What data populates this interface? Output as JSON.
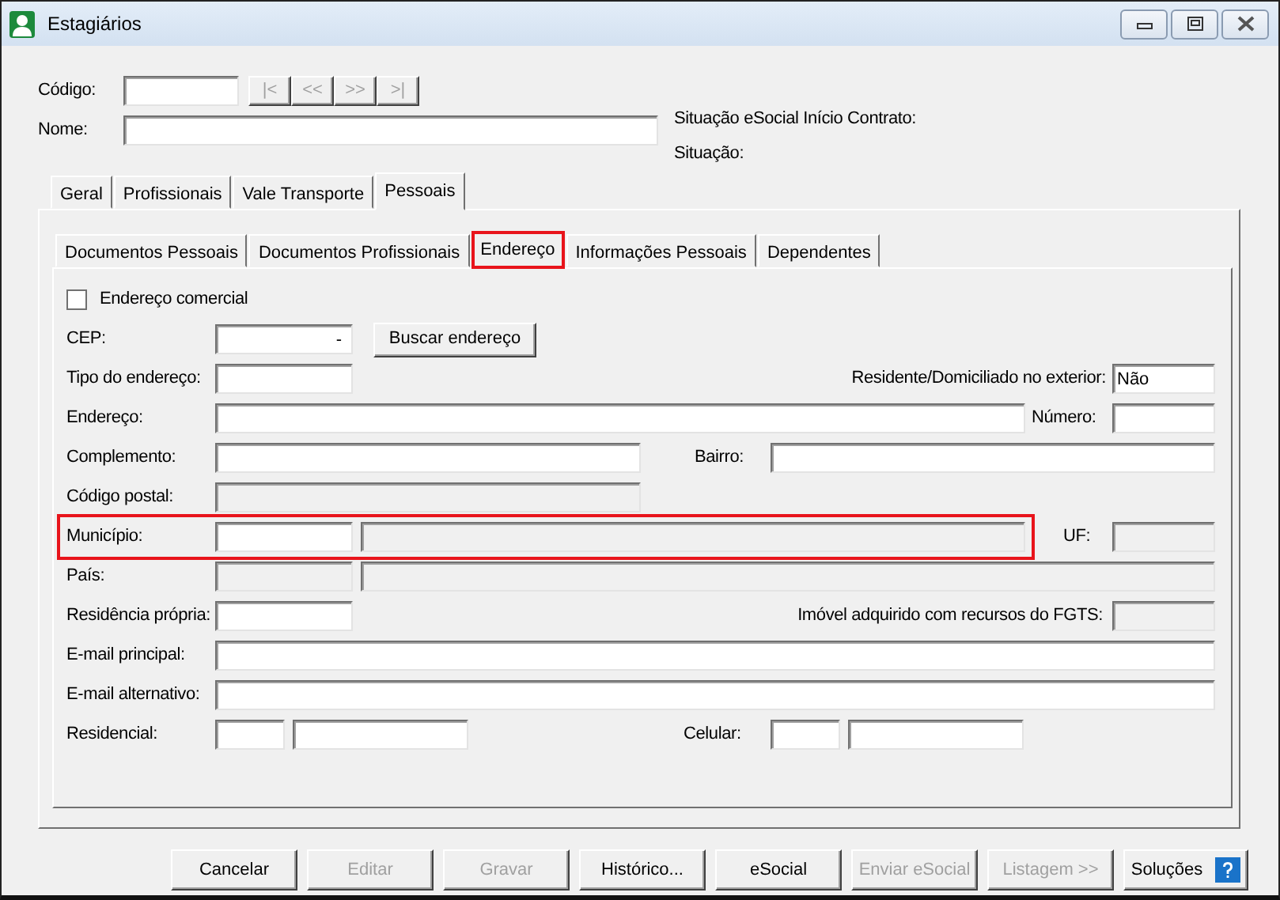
{
  "window": {
    "title": "Estagiários"
  },
  "header": {
    "codigo_label": "Código:",
    "nav_buttons": [
      {
        "label": "|<",
        "disabled": true
      },
      {
        "label": "<<",
        "disabled": true
      },
      {
        "label": ">>",
        "disabled": true
      },
      {
        "label": ">|",
        "disabled": true
      }
    ],
    "nome_label": "Nome:",
    "status_lines": [
      "Situação eSocial Início Contrato:",
      "Situação:"
    ]
  },
  "tabs": [
    {
      "label": "Geral",
      "selected": false
    },
    {
      "label": "Profissionais",
      "selected": false
    },
    {
      "label": "Vale Transporte",
      "selected": false
    },
    {
      "label": "Pessoais",
      "selected": true
    }
  ],
  "subtabs": [
    {
      "label": "Documentos Pessoais",
      "selected": false,
      "highlighted": false
    },
    {
      "label": "Documentos Profissionais",
      "selected": false,
      "highlighted": false
    },
    {
      "label": "Endereço",
      "selected": true,
      "highlighted": true
    },
    {
      "label": "Informações Pessoais",
      "selected": false,
      "highlighted": false
    },
    {
      "label": "Dependentes",
      "selected": false,
      "highlighted": false
    }
  ],
  "rows": [
    {
      "highlighted": false,
      "items": [
        {
          "kind": "checkbox",
          "label": "Endereço comercial",
          "checked": false
        }
      ]
    },
    {
      "highlighted": false,
      "items": [
        {
          "kind": "label",
          "text": "CEP:"
        },
        {
          "kind": "input",
          "value": "-",
          "disabled": false
        },
        {
          "kind": "button",
          "label": "Buscar endereço",
          "disabled": false
        }
      ]
    },
    {
      "highlighted": false,
      "items": [
        {
          "kind": "label",
          "text": "Tipo do endereço:"
        },
        {
          "kind": "input",
          "value": "",
          "disabled": false
        },
        {
          "kind": "label",
          "text": "Residente/Domiciliado no exterior:"
        },
        {
          "kind": "input",
          "value": "Não",
          "disabled": false
        }
      ]
    },
    {
      "highlighted": false,
      "items": [
        {
          "kind": "label",
          "text": "Endereço:"
        },
        {
          "kind": "input",
          "value": "",
          "disabled": false
        },
        {
          "kind": "label",
          "text": "Número:"
        },
        {
          "kind": "input",
          "value": "",
          "disabled": false
        }
      ]
    },
    {
      "highlighted": false,
      "items": [
        {
          "kind": "label",
          "text": "Complemento:"
        },
        {
          "kind": "input",
          "value": "",
          "disabled": false
        },
        {
          "kind": "label",
          "text": "Bairro:"
        },
        {
          "kind": "input",
          "value": "",
          "disabled": false
        }
      ]
    },
    {
      "highlighted": false,
      "items": [
        {
          "kind": "label",
          "text": "Código postal:"
        },
        {
          "kind": "input",
          "value": "",
          "disabled": true
        }
      ]
    },
    {
      "highlighted": true,
      "items": [
        {
          "kind": "label",
          "text": "Município:"
        },
        {
          "kind": "input",
          "value": "",
          "disabled": false
        },
        {
          "kind": "input",
          "value": "",
          "disabled": true
        },
        {
          "kind": "label",
          "text": "UF:"
        },
        {
          "kind": "input",
          "value": "",
          "disabled": true
        }
      ]
    },
    {
      "highlighted": false,
      "items": [
        {
          "kind": "label",
          "text": "País:"
        },
        {
          "kind": "input",
          "value": "",
          "disabled": true
        },
        {
          "kind": "input",
          "value": "",
          "disabled": true
        }
      ]
    },
    {
      "highlighted": false,
      "items": [
        {
          "kind": "label",
          "text": "Residência própria:"
        },
        {
          "kind": "input",
          "value": "",
          "disabled": false
        },
        {
          "kind": "label",
          "text": "Imóvel adquirido com recursos do FGTS:"
        },
        {
          "kind": "input",
          "value": "",
          "disabled": true
        }
      ]
    },
    {
      "highlighted": false,
      "items": [
        {
          "kind": "label",
          "text": "E-mail principal:"
        },
        {
          "kind": "input",
          "value": "",
          "disabled": false
        }
      ]
    },
    {
      "highlighted": false,
      "items": [
        {
          "kind": "label",
          "text": "E-mail alternativo:"
        },
        {
          "kind": "input",
          "value": "",
          "disabled": false
        }
      ]
    },
    {
      "highlighted": false,
      "items": [
        {
          "kind": "label",
          "text": "Residencial:"
        },
        {
          "kind": "input",
          "value": "",
          "disabled": false
        },
        {
          "kind": "input",
          "value": "",
          "disabled": false
        },
        {
          "kind": "label",
          "text": "Celular:"
        },
        {
          "kind": "input",
          "value": "",
          "disabled": false
        },
        {
          "kind": "input",
          "value": "",
          "disabled": false
        }
      ]
    }
  ],
  "buttons": [
    {
      "label": "Cancelar",
      "disabled": false
    },
    {
      "label": "Editar",
      "disabled": true
    },
    {
      "label": "Gravar",
      "disabled": true
    },
    {
      "label": "Histórico...",
      "disabled": false
    },
    {
      "label": "eSocial",
      "disabled": false
    },
    {
      "label": "Enviar eSocial",
      "disabled": true
    },
    {
      "label": "Listagem >>",
      "disabled": true
    },
    {
      "label": "Soluções",
      "disabled": false,
      "help_icon": true
    }
  ]
}
